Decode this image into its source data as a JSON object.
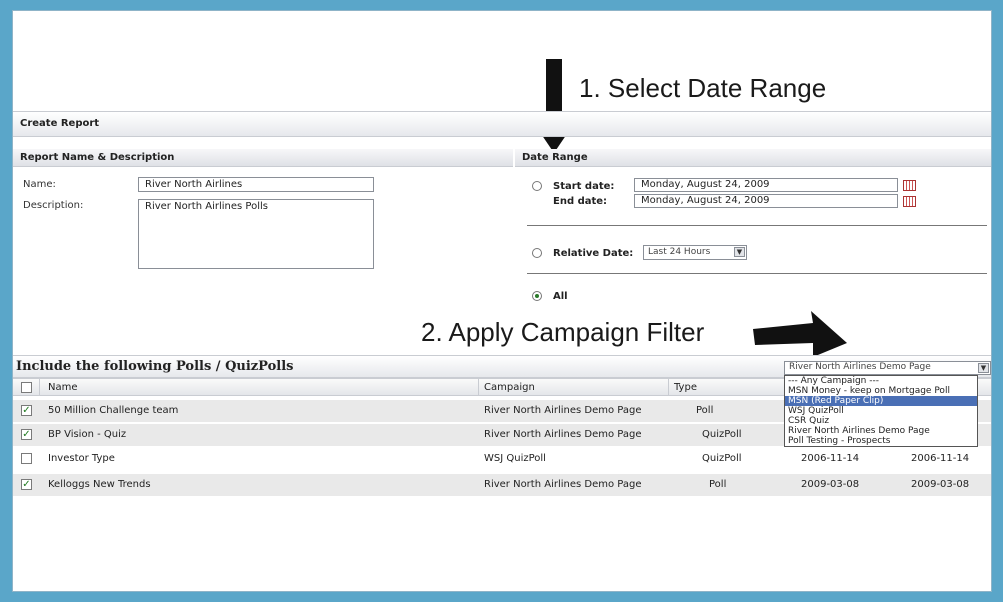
{
  "annotations": {
    "step1": "1. Select Date Range",
    "step2": "2. Apply Campaign Filter"
  },
  "header": {
    "title": "Create Report"
  },
  "report": {
    "section_title": "Report Name & Description",
    "name_label": "Name:",
    "name_value": "River North Airlines",
    "description_label": "Description:",
    "description_value": "River North Airlines Polls"
  },
  "date_range": {
    "section_title": "Date Range",
    "start_label": "Start date:",
    "start_value": "Monday, August 24, 2009",
    "end_label": "End date:",
    "end_value": "Monday, August 24, 2009",
    "relative_label": "Relative Date:",
    "relative_value": "Last 24 Hours",
    "all_label": "All",
    "selected": "All"
  },
  "polls": {
    "title": "Include the following Polls / QuizPolls",
    "campaign_filter_value": "River North Airlines Demo Page",
    "campaign_options": [
      "--- Any Campaign ---",
      "MSN Money - keep on Mortgage Poll",
      "MSN (Red Paper Clip)",
      "WSJ QuizPoll",
      "CSR Quiz",
      "River North Airlines Demo Page",
      "Poll Testing - Prospects"
    ],
    "highlighted_option": "MSN (Red Paper Clip)",
    "columns": [
      "Name",
      "Campaign",
      "Type"
    ],
    "rows": [
      {
        "checked": true,
        "name": "50 Million Challenge team",
        "campaign": "River North Airlines Demo Page",
        "type": "Poll",
        "start": "",
        "end": ""
      },
      {
        "checked": true,
        "name": "BP Vision - Quiz",
        "campaign": "River North Airlines Demo Page",
        "type": "QuizPoll",
        "start": "",
        "end": ""
      },
      {
        "checked": false,
        "name": "Investor Type",
        "campaign": "WSJ QuizPoll",
        "type": "QuizPoll",
        "start": "2006-11-14",
        "end": "2006-11-14"
      },
      {
        "checked": true,
        "name": "Kelloggs New Trends",
        "campaign": "River North Airlines Demo Page",
        "type": "Poll",
        "start": "2009-03-08",
        "end": "2009-03-08"
      }
    ]
  }
}
